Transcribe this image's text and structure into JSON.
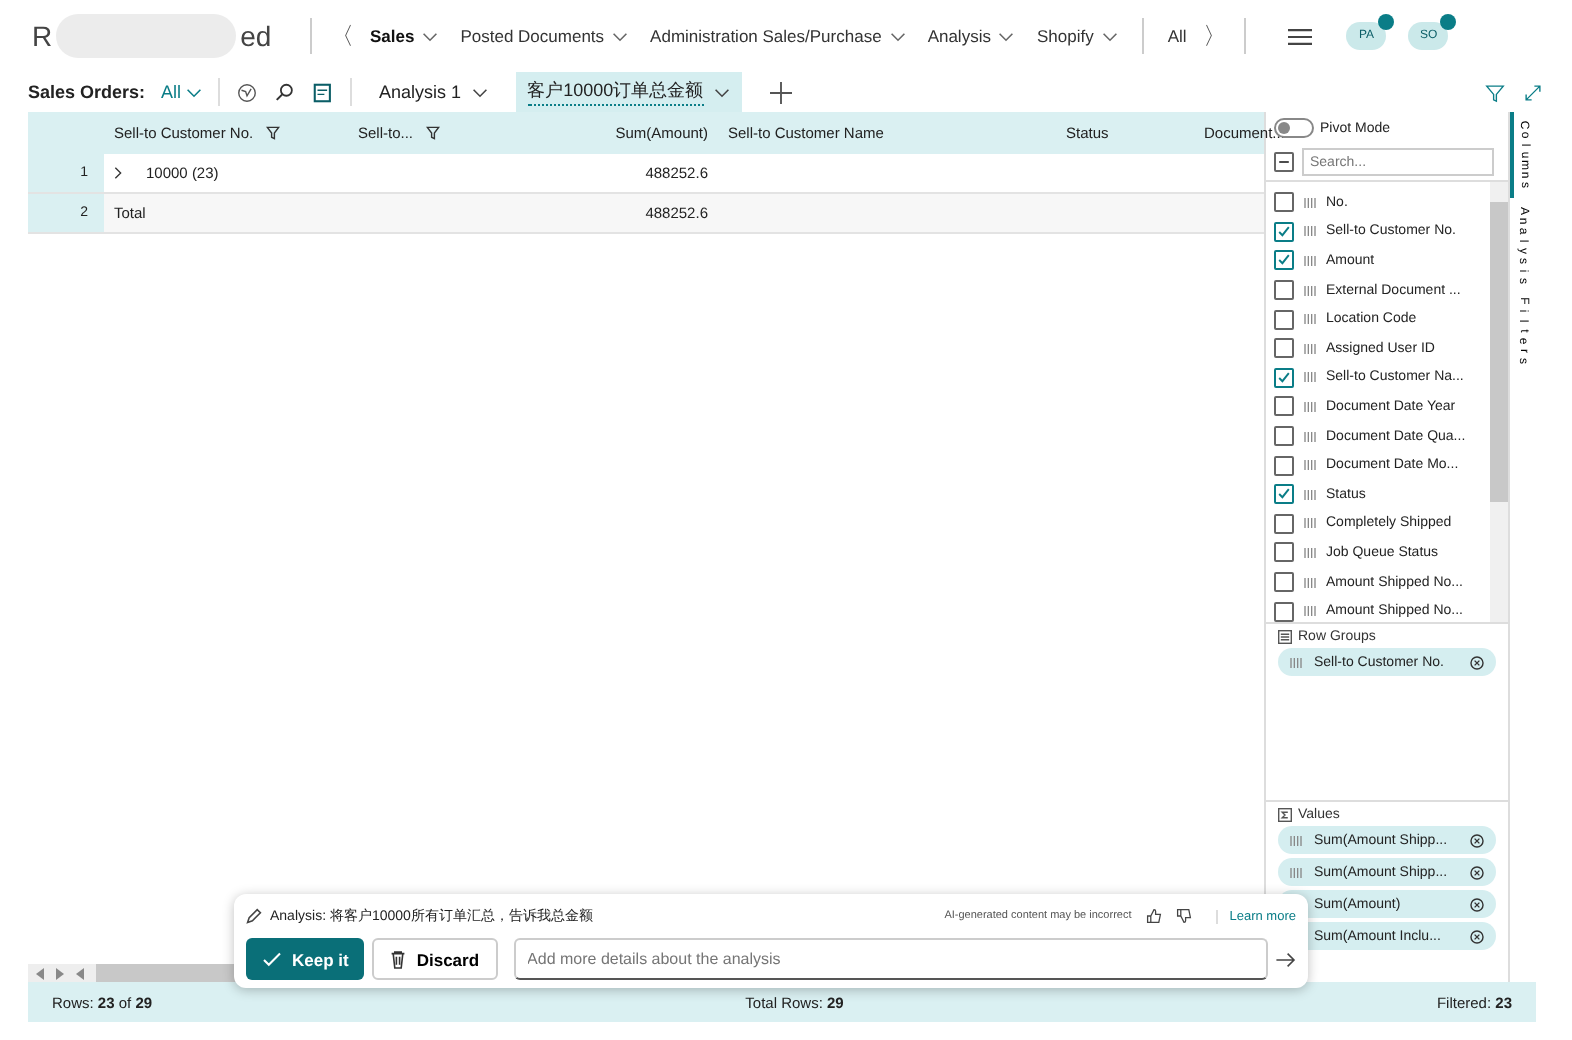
{
  "header": {
    "title_start": "R",
    "title_end": "ed",
    "back_glyph": "〈",
    "forward_glyph": "〉",
    "nav": [
      {
        "label": "Sales",
        "selected": true
      },
      {
        "label": "Posted Documents",
        "selected": false
      },
      {
        "label": "Administration Sales/Purchase",
        "selected": false
      },
      {
        "label": "Analysis",
        "selected": false
      },
      {
        "label": "Shopify",
        "selected": false
      }
    ],
    "all_label": "All",
    "avatars": [
      "PA",
      "SO"
    ]
  },
  "action_bar": {
    "list_label": "Sales Orders:",
    "filter_label": "All",
    "tabs": [
      {
        "label": "Analysis 1",
        "selected": false
      },
      {
        "label": "客户10000订单总金额",
        "selected": true
      }
    ]
  },
  "table": {
    "columns": [
      {
        "label": "Sell-to Customer No.",
        "filter": true
      },
      {
        "label": "Sell-to...",
        "filter": true
      },
      {
        "label": "Sum(Amount)",
        "filter": false
      },
      {
        "label": "Sell-to Customer Name",
        "filter": false
      },
      {
        "label": "Status",
        "filter": false
      },
      {
        "label": "Document...",
        "filter": false
      }
    ],
    "rows": [
      {
        "number": "1",
        "kind": "group",
        "cells": [
          "10000 (23)",
          "",
          "488252.6",
          "",
          "",
          ""
        ]
      },
      {
        "number": "2",
        "kind": "total",
        "cells": [
          "Total",
          "",
          "488252.6",
          "",
          "",
          ""
        ]
      }
    ]
  },
  "side_panel": {
    "pivot_mode": {
      "label": "Pivot Mode",
      "on": false
    },
    "search": {
      "placeholder": "Search..."
    },
    "select_all": {
      "partial": true
    },
    "columns": [
      {
        "label": "No.",
        "checked": false
      },
      {
        "label": "Sell-to Customer No.",
        "checked": true
      },
      {
        "label": "Amount",
        "checked": true
      },
      {
        "label": "External Document ...",
        "checked": false
      },
      {
        "label": "Location Code",
        "checked": false
      },
      {
        "label": "Assigned User ID",
        "checked": false
      },
      {
        "label": "Sell-to Customer Na...",
        "checked": true
      },
      {
        "label": "Document Date Year",
        "checked": false
      },
      {
        "label": "Document Date Qua...",
        "checked": false
      },
      {
        "label": "Document Date Mo...",
        "checked": false
      },
      {
        "label": "Status",
        "checked": true
      },
      {
        "label": "Completely Shipped",
        "checked": false
      },
      {
        "label": "Job Queue Status",
        "checked": false
      },
      {
        "label": "Amount Shipped No...",
        "checked": false
      },
      {
        "label": "Amount Shipped No...",
        "checked": false
      }
    ],
    "row_groups": {
      "title": "Row Groups",
      "items": [
        "Sell-to Customer No."
      ]
    },
    "values": {
      "title": "Values",
      "items": [
        "Sum(Amount Shipp...",
        "Sum(Amount Shipp...",
        "Sum(Amount)",
        "Sum(Amount Inclu..."
      ]
    },
    "tabs": [
      {
        "label": "Columns",
        "selected": true
      },
      {
        "label": "Analysis Filters",
        "selected": false
      }
    ]
  },
  "copilot": {
    "analysis_text": "Analysis: 将客户10000所有订单汇总，告诉我总金额",
    "disclaimer": "AI-generated content may be incorrect",
    "learn_more": "Learn more",
    "keep_label": "Keep it",
    "discard_label": "Discard",
    "input": {
      "placeholder": "Add more details about the analysis"
    }
  },
  "status_bar": {
    "rows": "Rows: **23** of **29**",
    "total": "Total Rows: **29**",
    "filtered": "Filtered: **23**"
  }
}
